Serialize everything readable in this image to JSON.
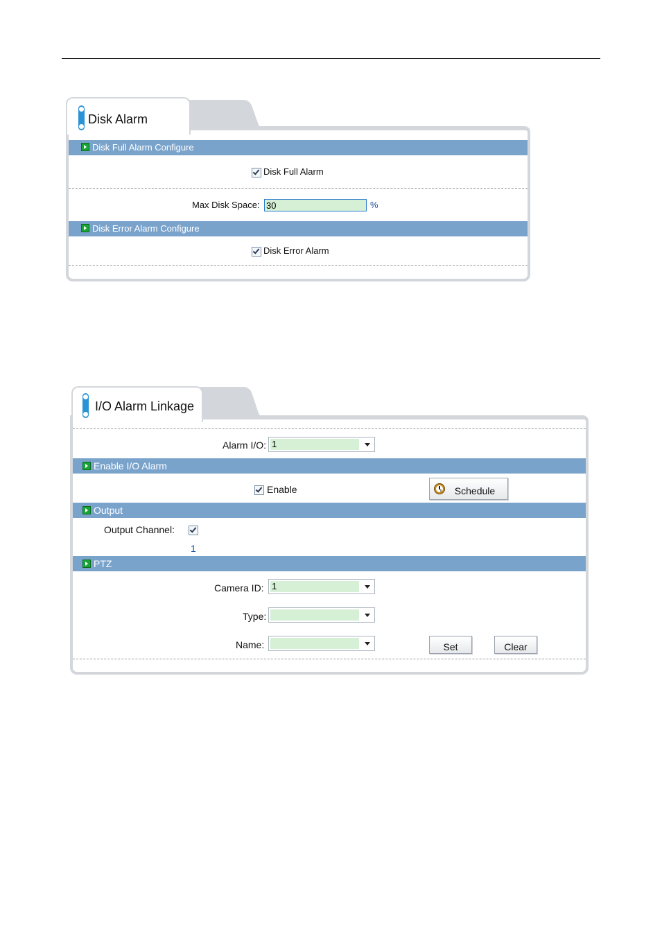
{
  "disk_alarm": {
    "title": "Disk Alarm",
    "sections": {
      "full": "Disk Full Alarm Configure",
      "error": "Disk Error Alarm Configure"
    },
    "disk_full_alarm": {
      "label": "Disk Full Alarm",
      "checked": true
    },
    "max_disk_space": {
      "label": "Max Disk Space:",
      "value": "30",
      "unit": "%"
    },
    "disk_error_alarm": {
      "label": "Disk Error Alarm",
      "checked": true
    }
  },
  "io_alarm": {
    "title": "I/O Alarm Linkage",
    "alarm_io": {
      "label": "Alarm I/O:",
      "value": "1"
    },
    "sections": {
      "enable": "Enable I/O Alarm",
      "output": "Output",
      "ptz": "PTZ"
    },
    "enable": {
      "label": "Enable",
      "checked": true
    },
    "schedule_button": "Schedule",
    "output_channel": {
      "label": "Output Channel:",
      "checked": true,
      "channel": "1"
    },
    "camera_id": {
      "label": "Camera ID:",
      "value": "1"
    },
    "type": {
      "label": "Type:",
      "value": ""
    },
    "name": {
      "label": "Name:",
      "value": ""
    },
    "set_button": "Set",
    "clear_button": "Clear"
  },
  "colors": {
    "section_bar": "#7aa3cc",
    "field_fill": "#d6f0d6",
    "tab_accent": "#2a93d5",
    "frame": "#d3d6da"
  }
}
